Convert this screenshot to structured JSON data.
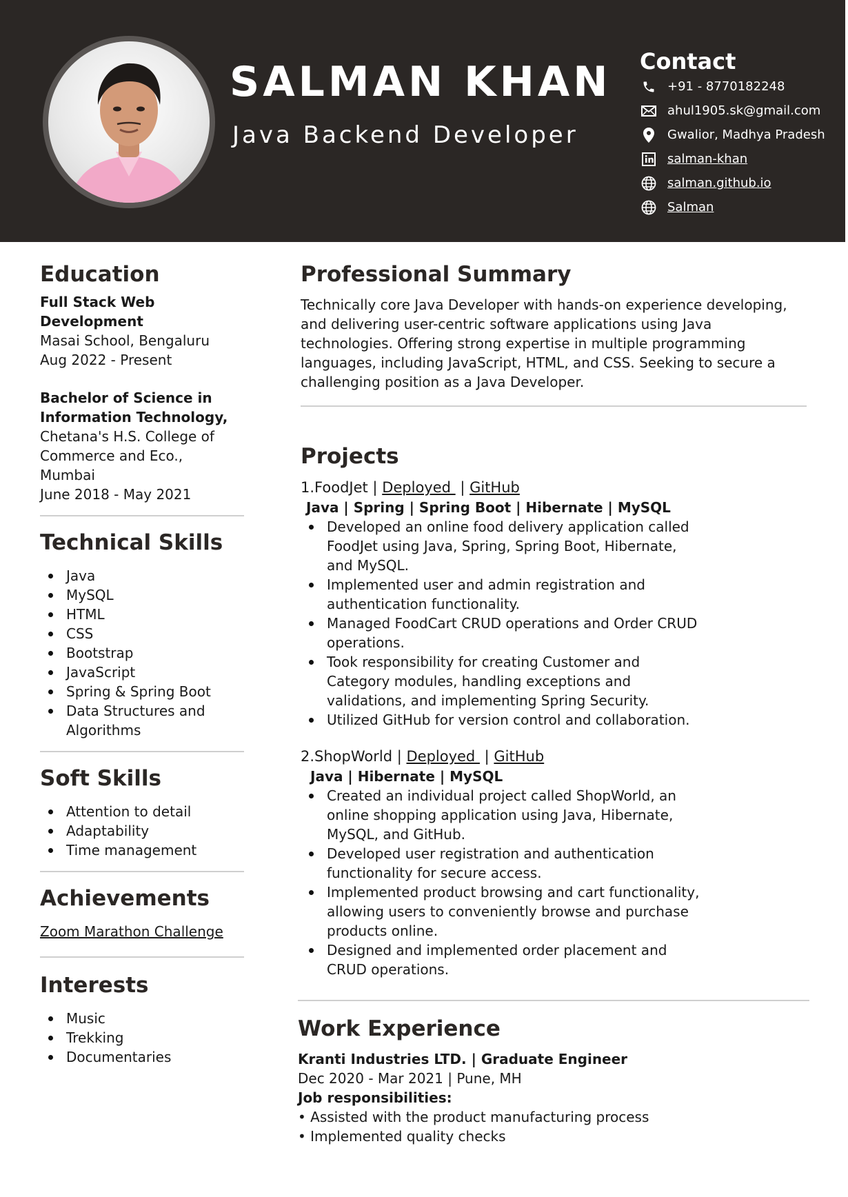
{
  "header": {
    "name": "SALMAN KHAN",
    "role": "Java Backend Developer"
  },
  "contact": {
    "title": "Contact",
    "items": [
      {
        "icon": "phone-icon",
        "text": "+91 - 8770182248"
      },
      {
        "icon": "mail-icon",
        "text": "ahul1905.sk@gmail.com"
      },
      {
        "icon": "location-pin-icon",
        "text": "Gwalior, Madhya Pradesh"
      },
      {
        "icon": "linkedin-icon",
        "text": "salman-khan"
      },
      {
        "icon": "globe-icon",
        "text": "salman.github.io"
      },
      {
        "icon": "globe-icon",
        "text": "Salman"
      }
    ]
  },
  "education": {
    "title": "Education",
    "entries": [
      {
        "degree": "Full Stack Web Development",
        "school": "Masai School, Bengaluru",
        "dates": "Aug 2022 - Present"
      },
      {
        "degree_line1": "Bachelor of Science in",
        "degree_line2": "Information Technology,",
        "school_line1": "Chetana's H.S. College of",
        "school_line2": "Commerce and Eco.,",
        "school_line3": "Mumbai",
        "dates": "June 2018 - May 2021"
      }
    ]
  },
  "technical_skills": {
    "title": "Technical Skills",
    "items": [
      "Java",
      "MySQL",
      "HTML",
      "CSS",
      "Bootstrap",
      "JavaScript",
      "Spring & Spring Boot",
      "Data Structures and",
      "Algorithms"
    ]
  },
  "soft_skills": {
    "title": "Soft Skills",
    "items": [
      "Attention to detail",
      "Adaptability",
      "Time management"
    ]
  },
  "achievements": {
    "title": "Achievements",
    "items": [
      "Zoom Marathon Challenge"
    ]
  },
  "interests": {
    "title": "Interests",
    "items": [
      "Music",
      "Trekking",
      "Documentaries"
    ]
  },
  "summary": {
    "title": "Professional Summary",
    "lines": [
      "Technically core Java Developer with hands-on experience developing,",
      "and delivering user-centric software applications using Java",
      "technologies. Offering strong expertise in multiple programming",
      "languages, including JavaScript, HTML, and CSS. Seeking to secure a",
      "challenging position as a Java Developer."
    ]
  },
  "projects": {
    "title": "Projects",
    "items": [
      {
        "name": "1.FoodJet",
        "sep1": " | ",
        "deployed": "Deployed ",
        "sep2": " | ",
        "github": "GitHub",
        "stack": "Java | Spring | Spring Boot | Hibernate | MySQL",
        "bullets": [
          [
            "Developed an online food delivery application called",
            "FoodJet using Java, Spring, Spring Boot, Hibernate,",
            "and MySQL."
          ],
          [
            "Implemented user and admin registration and",
            "authentication functionality."
          ],
          [
            "Managed FoodCart CRUD operations and Order CRUD",
            "operations."
          ],
          [
            "Took responsibility for creating Customer and",
            "Category modules, handling exceptions and",
            "validations, and implementing Spring Security."
          ],
          [
            "Utilized GitHub for version control and collaboration."
          ]
        ]
      },
      {
        "name": "2.ShopWorld",
        "sep1": " | ",
        "deployed": "Deployed ",
        "sep2": " | ",
        "github": "GitHub",
        "stack": "Java | Hibernate | MySQL",
        "bullets": [
          [
            "Created an individual project called ShopWorld, an",
            "online shopping application using Java, Hibernate,",
            "MySQL, and GitHub."
          ],
          [
            "Developed user registration and authentication",
            "functionality for secure access."
          ],
          [
            "Implemented product browsing and cart functionality,",
            "allowing users to conveniently browse and purchase",
            "products online."
          ],
          [
            "Designed and implemented order placement and",
            "CRUD operations."
          ]
        ]
      }
    ]
  },
  "work": {
    "title": "Work Experience",
    "company": "Kranti Industries LTD. | Graduate Engineer",
    "dates": "Dec 2020 - Mar 2021 | Pune, MH",
    "resp_title": "Job responsibilities:",
    "items": [
      "• Assisted with the product manufacturing process",
      "• Implemented quality checks"
    ]
  }
}
